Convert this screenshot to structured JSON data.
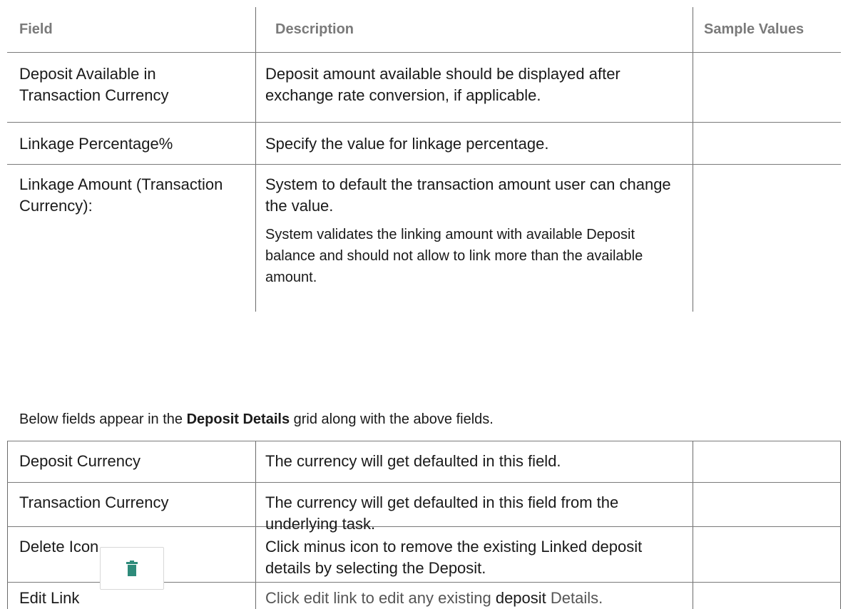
{
  "table": {
    "headers": [
      "Field",
      "Description",
      "Sample Values"
    ],
    "rows_top": [
      {
        "field": "Deposit Available in Transaction Currency",
        "description": "Deposit amount available should be displayed after exchange rate conversion, if applicable.",
        "sample": ""
      },
      {
        "field": "Linkage Percentage%",
        "description": "Specify the value for linkage percentage.",
        "sample": ""
      },
      {
        "field": "Linkage Amount (Transaction Currency):",
        "description_paragraphs": [
          "System to default the transaction amount user can change the value.",
          "System validates the linking amount with available Deposit balance and should not allow to link more than the available amount."
        ],
        "sample": ""
      }
    ],
    "note": {
      "prefix": "Below fields appear in the ",
      "bold": "Deposit Details",
      "suffix": " grid along with the above fields."
    },
    "rows_bottom": [
      {
        "field": "Deposit Currency",
        "description": "The currency will get defaulted in this field.",
        "sample": ""
      },
      {
        "field": "Transaction Currency",
        "description": "The currency will get defaulted in this field from the underlying task.",
        "sample": ""
      },
      {
        "field": "Delete Icon",
        "description": "Click minus icon to remove the existing Linked deposit details by selecting the Deposit.",
        "icon": "trash-icon",
        "sample": ""
      },
      {
        "field": "Edit Link",
        "description_parts": [
          "Click edit link to edit any existing ",
          "deposit",
          " Details."
        ],
        "sample": ""
      }
    ]
  },
  "colors": {
    "header_text": "#7a7a7a",
    "border": "#6b6b6b",
    "icon": "#2e8b7a"
  }
}
